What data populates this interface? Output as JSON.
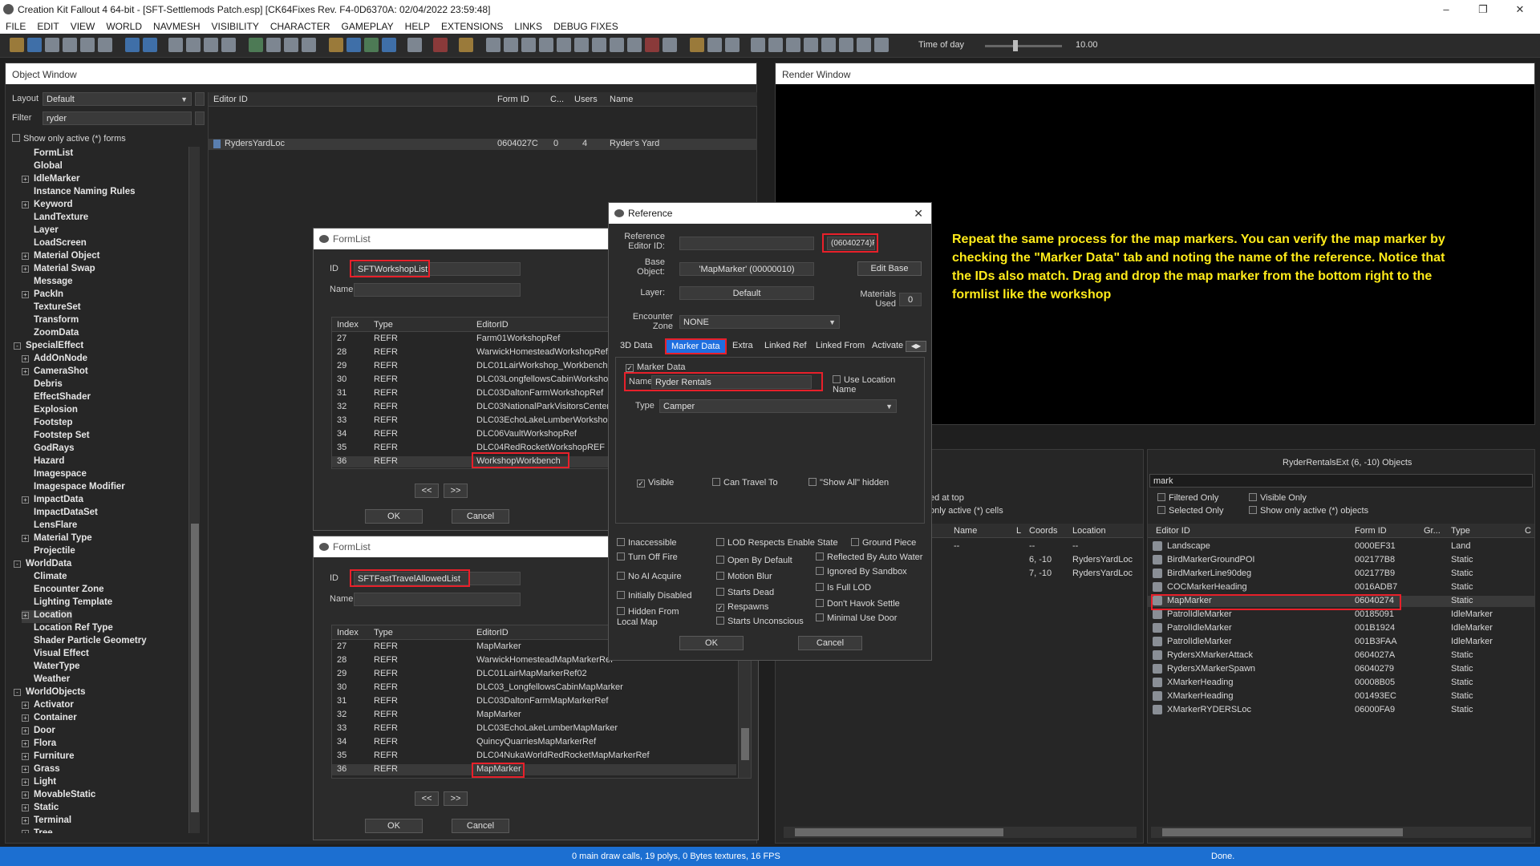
{
  "titlebar": {
    "title": "Creation Kit Fallout 4 64-bit - [SFT-Settlemods Patch.esp] [CK64Fixes Rev. F4-0D6370A: 02/04/2022 23:59:48]"
  },
  "menu": [
    "FILE",
    "EDIT",
    "VIEW",
    "WORLD",
    "NAVMESH",
    "VISIBILITY",
    "CHARACTER",
    "GAMEPLAY",
    "HELP",
    "EXTENSIONS",
    "LINKS",
    "DEBUG FIXES"
  ],
  "toolbar": {
    "time_label": "Time of day",
    "time_value": "10.00"
  },
  "object_window": {
    "title": "Object Window",
    "layout_label": "Layout",
    "layout_value": "Default",
    "filter_label": "Filter",
    "filter_value": "ryder",
    "show_active": "Show only active (*) forms",
    "tree": [
      {
        "label": "FormList",
        "level": 1,
        "exp": ""
      },
      {
        "label": "Global",
        "level": 1,
        "exp": ""
      },
      {
        "label": "IdleMarker",
        "level": 1,
        "exp": "+"
      },
      {
        "label": "Instance Naming Rules",
        "level": 1,
        "exp": ""
      },
      {
        "label": "Keyword",
        "level": 1,
        "exp": "+"
      },
      {
        "label": "LandTexture",
        "level": 1,
        "exp": ""
      },
      {
        "label": "Layer",
        "level": 1,
        "exp": ""
      },
      {
        "label": "LoadScreen",
        "level": 1,
        "exp": ""
      },
      {
        "label": "Material Object",
        "level": 1,
        "exp": "+"
      },
      {
        "label": "Material Swap",
        "level": 1,
        "exp": "+"
      },
      {
        "label": "Message",
        "level": 1,
        "exp": ""
      },
      {
        "label": "PackIn",
        "level": 1,
        "exp": "+"
      },
      {
        "label": "TextureSet",
        "level": 1,
        "exp": ""
      },
      {
        "label": "Transform",
        "level": 1,
        "exp": ""
      },
      {
        "label": "ZoomData",
        "level": 1,
        "exp": ""
      },
      {
        "label": "SpecialEffect",
        "level": 0,
        "exp": "-"
      },
      {
        "label": "AddOnNode",
        "level": 1,
        "exp": "+"
      },
      {
        "label": "CameraShot",
        "level": 1,
        "exp": "+"
      },
      {
        "label": "Debris",
        "level": 1,
        "exp": ""
      },
      {
        "label": "EffectShader",
        "level": 1,
        "exp": ""
      },
      {
        "label": "Explosion",
        "level": 1,
        "exp": ""
      },
      {
        "label": "Footstep",
        "level": 1,
        "exp": ""
      },
      {
        "label": "Footstep Set",
        "level": 1,
        "exp": ""
      },
      {
        "label": "GodRays",
        "level": 1,
        "exp": ""
      },
      {
        "label": "Hazard",
        "level": 1,
        "exp": ""
      },
      {
        "label": "Imagespace",
        "level": 1,
        "exp": ""
      },
      {
        "label": "Imagespace Modifier",
        "level": 1,
        "exp": ""
      },
      {
        "label": "ImpactData",
        "level": 1,
        "exp": "+"
      },
      {
        "label": "ImpactDataSet",
        "level": 1,
        "exp": ""
      },
      {
        "label": "LensFlare",
        "level": 1,
        "exp": ""
      },
      {
        "label": "Material Type",
        "level": 1,
        "exp": "+"
      },
      {
        "label": "Projectile",
        "level": 1,
        "exp": ""
      },
      {
        "label": "WorldData",
        "level": 0,
        "exp": "-"
      },
      {
        "label": "Climate",
        "level": 1,
        "exp": ""
      },
      {
        "label": "Encounter Zone",
        "level": 1,
        "exp": ""
      },
      {
        "label": "Lighting Template",
        "level": 1,
        "exp": ""
      },
      {
        "label": "Location",
        "level": 1,
        "exp": "+",
        "selected": true
      },
      {
        "label": "Location Ref Type",
        "level": 1,
        "exp": ""
      },
      {
        "label": "Shader Particle Geometry",
        "level": 1,
        "exp": ""
      },
      {
        "label": "Visual Effect",
        "level": 1,
        "exp": ""
      },
      {
        "label": "WaterType",
        "level": 1,
        "exp": ""
      },
      {
        "label": "Weather",
        "level": 1,
        "exp": ""
      },
      {
        "label": "WorldObjects",
        "level": 0,
        "exp": "-"
      },
      {
        "label": "Activator",
        "level": 1,
        "exp": "+"
      },
      {
        "label": "Container",
        "level": 1,
        "exp": "+"
      },
      {
        "label": "Door",
        "level": 1,
        "exp": "+"
      },
      {
        "label": "Flora",
        "level": 1,
        "exp": "+"
      },
      {
        "label": "Furniture",
        "level": 1,
        "exp": "+"
      },
      {
        "label": "Grass",
        "level": 1,
        "exp": "+"
      },
      {
        "label": "Light",
        "level": 1,
        "exp": "+"
      },
      {
        "label": "MovableStatic",
        "level": 1,
        "exp": "+"
      },
      {
        "label": "Static",
        "level": 1,
        "exp": "+"
      },
      {
        "label": "Terminal",
        "level": 1,
        "exp": "+"
      },
      {
        "label": "Tree",
        "level": 1,
        "exp": "+"
      }
    ],
    "columns": [
      "Editor ID",
      "Form ID",
      "C...",
      "Users",
      "Name"
    ],
    "rows": [
      {
        "editor_id": "RydersYardLoc",
        "form_id": "0604027C",
        "c": "0",
        "users": "4",
        "name": "Ryder's Yard"
      }
    ]
  },
  "render_window": {
    "title": "Render Window"
  },
  "annotation": "Repeat the same process for the map markers. You can verify the map marker by checking the \"Marker Data\" tab and noting the name of the reference. Notice that the IDs also match. Drag and drop the map marker from the bottom right to the formlist like the workshop",
  "formlist1": {
    "title": "FormList",
    "id_label": "ID",
    "id_value": "SFTWorkshopList",
    "name_label": "Name",
    "name_value": "",
    "columns": [
      "Index",
      "Type",
      "EditorID"
    ],
    "rows": [
      [
        "27",
        "REFR",
        "Farm01WorkshopRef"
      ],
      [
        "28",
        "REFR",
        "WarwickHomesteadWorkshopRef"
      ],
      [
        "29",
        "REFR",
        "DLC01LairWorkshop_Workbench"
      ],
      [
        "30",
        "REFR",
        "DLC03LongfellowsCabinWorkshop"
      ],
      [
        "31",
        "REFR",
        "DLC03DaltonFarmWorkshopRef"
      ],
      [
        "32",
        "REFR",
        "DLC03NationalParkVisitorsCenter"
      ],
      [
        "33",
        "REFR",
        "DLC03EchoLakeLumberWorkshop"
      ],
      [
        "34",
        "REFR",
        "DLC06VaultWorkshopRef"
      ],
      [
        "35",
        "REFR",
        "DLC04RedRocketWorkshopREF"
      ],
      [
        "36",
        "REFR",
        "WorkshopWorkbench"
      ]
    ],
    "prev": "<<",
    "next": ">>",
    "ok": "OK",
    "cancel": "Cancel"
  },
  "formlist2": {
    "title": "FormList",
    "id_label": "ID",
    "id_value": "SFTFastTravelAllowedList",
    "name_label": "Name",
    "name_value": "",
    "columns": [
      "Index",
      "Type",
      "EditorID"
    ],
    "rows": [
      [
        "27",
        "REFR",
        "MapMarker"
      ],
      [
        "28",
        "REFR",
        "WarwickHomesteadMapMarkerRef"
      ],
      [
        "29",
        "REFR",
        "DLC01LairMapMarkerRef02"
      ],
      [
        "30",
        "REFR",
        "DLC03_LongfellowsCabinMapMarker"
      ],
      [
        "31",
        "REFR",
        "DLC03DaltonFarmMapMarkerRef"
      ],
      [
        "32",
        "REFR",
        "MapMarker"
      ],
      [
        "33",
        "REFR",
        "DLC03EchoLakeLumberMapMarker"
      ],
      [
        "34",
        "REFR",
        "QuincyQuarriesMapMarkerRef"
      ],
      [
        "35",
        "REFR",
        "DLC04NukaWorldRedRocketMapMarkerRef"
      ],
      [
        "36",
        "REFR",
        "MapMarker"
      ]
    ],
    "prev": "<<",
    "next": ">>",
    "ok": "OK",
    "cancel": "Cancel"
  },
  "reference": {
    "title": "Reference",
    "ref_editor_id_label": "Reference Editor ID:",
    "ref_editor_id_value": "",
    "ref_id": "(06040274)P",
    "base_label": "Base Object:",
    "base_value": "'MapMarker' (00000010)",
    "edit_base": "Edit Base",
    "layer_label": "Layer:",
    "layer_value": "Default",
    "materials_label": "Materials Used",
    "materials_value": "0",
    "ez_label": "Encounter Zone",
    "ez_value": "NONE",
    "tabs": [
      "3D Data",
      "Marker Data",
      "Extra",
      "Linked Ref",
      "Linked From",
      "Activate"
    ],
    "marker_data_label": "Marker Data",
    "name_label": "Name",
    "name_value": "Ryder Rentals",
    "use_location_name": "Use Location Name",
    "type_label": "Type",
    "type_value": "Camper",
    "visible": "Visible",
    "can_travel": "Can Travel To",
    "show_all_hidden": "\"Show All\" hidden",
    "flags": {
      "inaccessible": "Inaccessible",
      "turn_off_fire": "Turn Off Fire",
      "no_ai_acquire": "No AI Acquire",
      "initially_disabled": "Initially Disabled",
      "hidden_local_map": "Hidden From Local Map",
      "lod_respects": "LOD Respects Enable State",
      "open_by_default": "Open By Default",
      "motion_blur": "Motion Blur",
      "starts_dead": "Starts Dead",
      "respawns": "Respawns",
      "starts_unconscious": "Starts Unconscious",
      "ground_piece": "Ground Piece",
      "reflected": "Reflected By Auto Water",
      "ignored_sandbox": "Ignored By Sandbox",
      "is_full_lod": "Is Full LOD",
      "dont_havok": "Don't Havok Settle",
      "minimal_use_door": "Minimal Use Door"
    },
    "ok": "OK",
    "cancel": "Cancel"
  },
  "cell_view": {
    "loaded_at_top": "ed at top",
    "only_active": "only active (*) cells",
    "columns": [
      "Name",
      "L",
      "Coords",
      "Location"
    ],
    "rows": [
      [
        "--",
        "",
        "--",
        "--"
      ],
      [
        "",
        "",
        "6, -10",
        "RydersYardLoc"
      ],
      [
        "",
        "",
        "7, -10",
        "RydersYardLoc"
      ]
    ]
  },
  "objects": {
    "title": "RyderRentalsExt (6, -10) Objects",
    "filter_value": "mark",
    "filtered_only": "Filtered Only",
    "visible_only": "Visible Only",
    "selected_only": "Selected Only",
    "show_active": "Show only active (*) objects",
    "columns": [
      "Editor ID",
      "Form ID",
      "Gr...",
      "Type",
      "C"
    ],
    "rows": [
      [
        "Landscape",
        "0000EF31",
        "",
        "Land"
      ],
      [
        "BirdMarkerGroundPOI",
        "002177B8",
        "",
        "Static"
      ],
      [
        "BirdMarkerLine90deg",
        "002177B9",
        "",
        "Static"
      ],
      [
        "COCMarkerHeading",
        "0016ADB7",
        "",
        "Static"
      ],
      [
        "MapMarker",
        "06040274",
        "",
        "Static"
      ],
      [
        "PatrolIdleMarker",
        "00185091",
        "",
        "IdleMarker"
      ],
      [
        "PatrolIdleMarker",
        "001B1924",
        "",
        "IdleMarker"
      ],
      [
        "PatrolIdleMarker",
        "001B3FAA",
        "",
        "IdleMarker"
      ],
      [
        "RydersXMarkerAttack",
        "0604027A",
        "",
        "Static"
      ],
      [
        "RydersXMarkerSpawn",
        "06040279",
        "",
        "Static"
      ],
      [
        "XMarkerHeading",
        "00008B05",
        "",
        "Static"
      ],
      [
        "XMarkerHeading",
        "001493EC",
        "",
        "Static"
      ],
      [
        "XMarkerRYDERSLoc",
        "06000FA9",
        "",
        "Static"
      ]
    ]
  },
  "status": {
    "left": "0 main draw calls, 19 polys, 0 Bytes textures, 16 FPS",
    "right": "Done."
  },
  "colors": {
    "highlight": "#e8202a",
    "annotation": "#ffeb1a",
    "status_bar": "#1c6fd1",
    "tab_active": "#1f6fe0"
  }
}
